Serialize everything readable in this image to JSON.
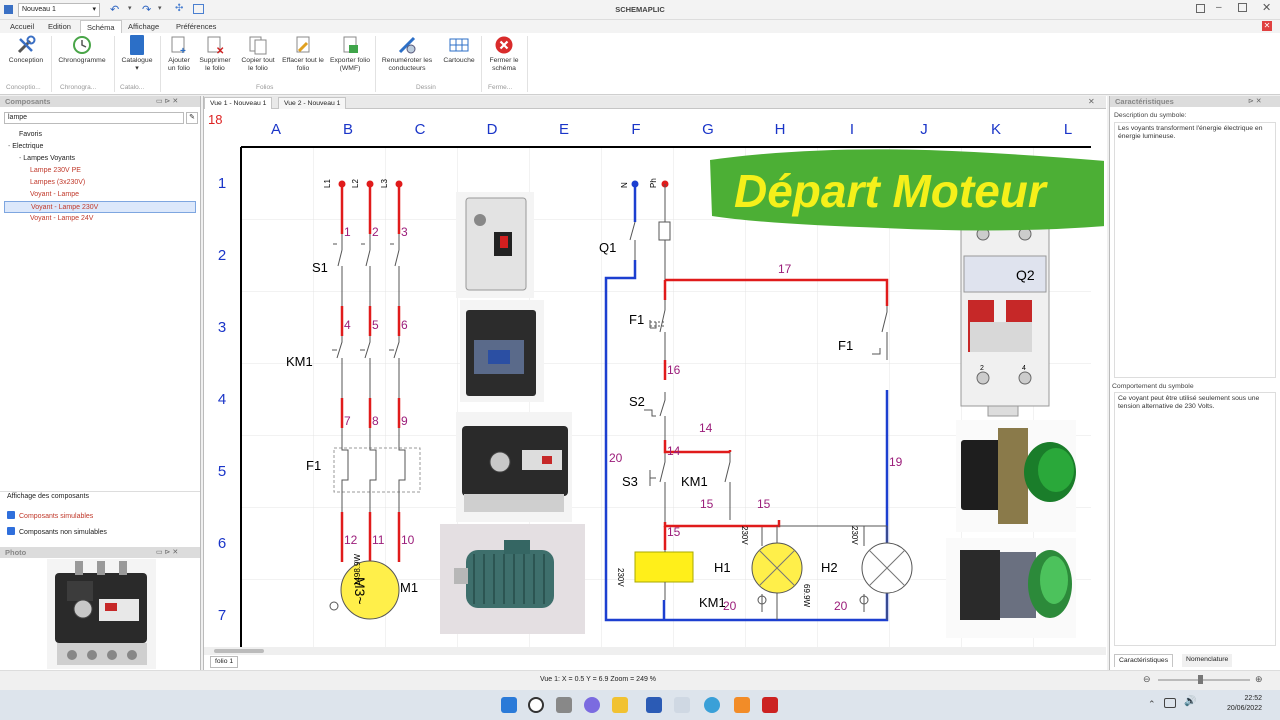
{
  "app": {
    "title": "SCHEMAPLIC",
    "document_select": "Nouveau 1"
  },
  "ribbon_tabs": [
    "Accueil",
    "Edition",
    "Schéma",
    "Affichage",
    "Préférences"
  ],
  "ribbon": {
    "buttons": {
      "conception": "Conception",
      "chronogramme": "Chronogramme",
      "catalogue": "Catalogue",
      "ajouter": "Ajouter un folio",
      "supprimer": "Supprimer le folio",
      "copier": "Copier tout le folio",
      "effacer": "Effacer tout le folio",
      "exporter": "Exporter folio (WMF)",
      "renumeroter": "Renuméroter les conducteurs",
      "cartouche": "Cartouche",
      "fermer": "Fermer le schéma"
    },
    "groups": {
      "conception": "Conceptio...",
      "chronogramme": "Chronogra...",
      "catalogue": "Catalo...",
      "folios": "Folios",
      "dessin": "Dessin",
      "fermer": "Ferme..."
    }
  },
  "left_panel": {
    "title": "Composants",
    "search_value": "lampe",
    "tree": [
      {
        "label": "Favoris",
        "level": 1,
        "red": false
      },
      {
        "label": "Electrique",
        "level": 0,
        "red": false,
        "exp": "-"
      },
      {
        "label": "Lampes Voyants",
        "level": 1,
        "red": false,
        "exp": "-"
      },
      {
        "label": "Lampe 230V PE",
        "level": 2,
        "red": true
      },
      {
        "label": "Lampes (3x230V)",
        "level": 2,
        "red": true
      },
      {
        "label": "Voyant - Lampe",
        "level": 2,
        "red": true
      },
      {
        "label": "Voyant - Lampe 230V",
        "level": 2,
        "red": true,
        "selected": true
      },
      {
        "label": "Voyant - Lampe 24V",
        "level": 2,
        "red": true
      }
    ],
    "display_title": "Affichage des composants",
    "opt_simulables": "Composants simulables",
    "opt_non_simulables": "Composants non simulables",
    "photo_title": "Photo"
  },
  "doc_tabs": [
    "Vue 1 - Nouveau 1",
    "Vue 2 - Nouveau 1"
  ],
  "canvas": {
    "corner": "18",
    "columns": [
      "A",
      "B",
      "C",
      "D",
      "E",
      "F",
      "G",
      "H",
      "I",
      "J",
      "K",
      "L"
    ],
    "rows": [
      "1",
      "2",
      "3",
      "4",
      "5",
      "6",
      "7"
    ],
    "banner": "Départ Moteur",
    "folio_tab": "folio 1"
  },
  "schematic": {
    "power_phases": [
      "L1",
      "L2",
      "L3"
    ],
    "power_wires_1": [
      "1",
      "2",
      "3"
    ],
    "power_wires_4": [
      "4",
      "5",
      "6"
    ],
    "power_wires_7": [
      "7",
      "8",
      "9"
    ],
    "power_wires_12": [
      "12",
      "11",
      "10"
    ],
    "s1": "S1",
    "km1": "KM1",
    "f1": "F1",
    "m1": "M1",
    "motor_symbol": "M3~",
    "motor_power": "1498.9W",
    "ctrl_n": "N",
    "ctrl_ph": "Ph",
    "q1": "Q1",
    "q2": "Q2",
    "wire_17": "17",
    "wire_16": "16",
    "wire_14": "14",
    "wire_14b": "14",
    "wire_15": "15",
    "wire_15b": "15",
    "wire_15c": "15",
    "wire_20": "20",
    "wire_19": "19",
    "wire_20b": "20",
    "wire_20c": "20",
    "f1_ctrl": "F1",
    "f1_ctrl2": "F1",
    "s2": "S2",
    "s3": "S3",
    "km1_ctrl": "KM1",
    "km1_coil": "KM1",
    "coil_v": "230V",
    "h1": "H1",
    "h2": "H2",
    "h1_v": "230V",
    "h2_v": "230V",
    "h1_w": "69.9W",
    "q2_terms": [
      "1",
      "3",
      "2",
      "4"
    ]
  },
  "right_panel": {
    "title": "Caractéristiques",
    "desc_label": "Description du symbole:",
    "desc_text": "Les voyants transforment l'énergie électrique en énergie lumineuse.",
    "behavior_label": "Comportement du symbole",
    "behavior_text": "Ce voyant peut être utilisé seulement sous une tension alternative de 230 Volts.",
    "tab1": "Caractéristiques",
    "tab2": "Nomenclature"
  },
  "status": {
    "text": "Vue 1: X = 0.5 Y = 6.9 Zoom = 249 %"
  },
  "taskbar": {
    "time": "22:52",
    "date": "20/06/2022"
  },
  "colors": {
    "banner_green": "#4caf35",
    "banner_text": "#f5f01a",
    "wire_red": "#e01b1b",
    "wire_blue": "#1c3fd0",
    "grid_blue": "#1a35c8"
  }
}
